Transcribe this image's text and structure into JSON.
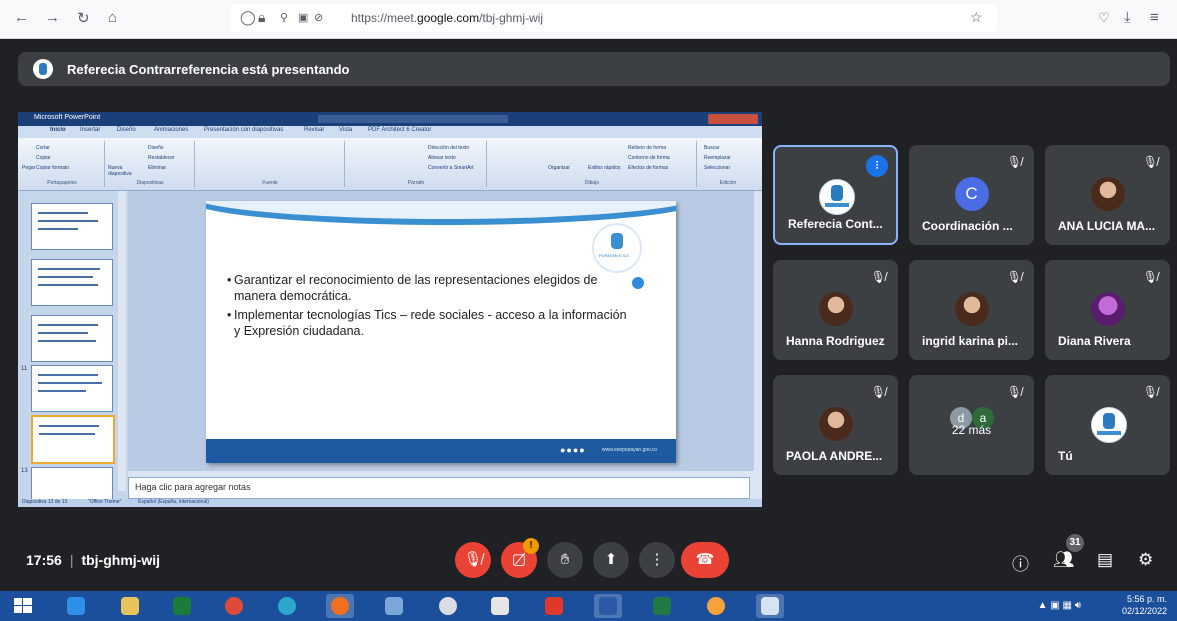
{
  "browser": {
    "url_prefix": "https://meet.",
    "url_domain": "google.com",
    "url_path": "/tbj-ghmj-wij"
  },
  "banner": {
    "text": "Referecia Contrarreferencia está presentando"
  },
  "ppt": {
    "window_title": "Microsoft PowerPoint",
    "tabs": [
      "Inicio",
      "Insertar",
      "Diseño",
      "Animaciones",
      "Presentación con diapositivas",
      "Revisar",
      "Vista",
      "PDF Architect 6 Creator"
    ],
    "groups": [
      {
        "label": "Portapapeles",
        "items": [
          "Cortar",
          "Copiar",
          "Copiar formato",
          "Pegar"
        ]
      },
      {
        "label": "Diapositivas",
        "items": [
          "Diseño",
          "Restablecer",
          "Nueva diapositiva",
          "Eliminar"
        ]
      },
      {
        "label": "Fuente",
        "items": []
      },
      {
        "label": "Párrafo",
        "items": [
          "Dirección del texto",
          "Alinear texto",
          "Convertir a SmartArt"
        ]
      },
      {
        "label": "Dibujo",
        "items": [
          "Organizar",
          "Estilos rápidos",
          "Relleno de forma",
          "Contorno de forma",
          "Efectos de formas"
        ]
      },
      {
        "label": "Edición",
        "items": [
          "Buscar",
          "Reemplazar",
          "Seleccionar"
        ]
      }
    ],
    "slide_numbers": [
      "",
      "",
      "",
      "11",
      "",
      "13"
    ],
    "slide": {
      "bullet1_line1": "Garantizar el reconocimiento de las representaciones elegidos de",
      "bullet1_line2": "manera democrática.",
      "bullet2_line1": "Implementar tecnologías Tics – rede sociales - acceso a la información",
      "bullet2_line2": "y Expresión ciudadana.",
      "logo_text": "POPAYÁN E.S.E.",
      "footer_url": "www.esepopayan.gov.co"
    },
    "notes_placeholder": "Haga clic para agregar notas",
    "status": [
      "Diapositiva 12 de 13",
      "\"Office Theme\"",
      "Español (España, internacional)"
    ]
  },
  "participants": [
    {
      "name": "Referecia Cont...",
      "avatar": "logo",
      "speaking": true,
      "muted": false
    },
    {
      "name": "Coordinación ...",
      "avatar": "letter",
      "letter": "C",
      "muted": true
    },
    {
      "name": "ANA LUCIA MA...",
      "avatar": "photo",
      "muted": true
    },
    {
      "name": "Hanna Rodriguez",
      "avatar": "photo",
      "muted": true
    },
    {
      "name": "ingrid karina pi...",
      "avatar": "photo",
      "muted": true
    },
    {
      "name": "Diana Rivera",
      "avatar": "photo",
      "muted": true
    },
    {
      "name": "PAOLA ANDRE...",
      "avatar": "photo",
      "muted": true
    },
    {
      "name": "22 más",
      "avatar": "group",
      "letters": [
        "d",
        "a"
      ],
      "muted": true
    },
    {
      "name": "Tú",
      "avatar": "logo",
      "muted": true
    }
  ],
  "meeting": {
    "time": "17:56",
    "code": "tbj-ghmj-wij",
    "people_count": "31",
    "camera_alert": "!"
  },
  "icons": {
    "mic": "mic-off-icon",
    "camera": "camera-off-icon",
    "hand": "raise-hand-icon",
    "present": "present-icon",
    "more": "more-options-icon",
    "end": "end-call-icon",
    "info": "info-icon",
    "people": "people-icon",
    "chat": "chat-icon",
    "activities": "activities-icon"
  },
  "colors": {
    "meet_bg": "#202124",
    "tile_bg": "#3c4043",
    "danger": "#ea4335",
    "accent": "#1a73e8",
    "taskbar": "#1b4f9c"
  },
  "taskbar": {
    "time": "5:56 p. m.",
    "date": "02/12/2022"
  }
}
